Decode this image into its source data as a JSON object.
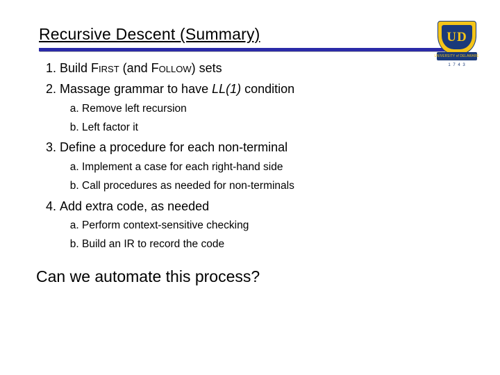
{
  "title": "Recursive Descent (Summary)",
  "logo": {
    "initials": "UD",
    "bannerText": "UNIVERSITY of DELAWARE",
    "year": "1 7 4 3"
  },
  "items": [
    {
      "pre": "Build ",
      "sc1": "First",
      "mid": " (and ",
      "sc2": "Follow",
      "post": ") sets",
      "sub": []
    },
    {
      "pre": "Massage grammar to have ",
      "ital": "LL(1)",
      "post": " condition",
      "sub": [
        "Remove left recursion",
        "Left factor it"
      ]
    },
    {
      "text": "Define a procedure for each non-terminal",
      "sub": [
        "Implement a case for each right-hand side",
        "Call procedures as needed for non-terminals"
      ]
    },
    {
      "text": "Add extra code, as needed",
      "sub": [
        "Perform context-sensitive checking",
        "Build an IR to record the code"
      ]
    }
  ],
  "footer": "Can we automate this process?"
}
